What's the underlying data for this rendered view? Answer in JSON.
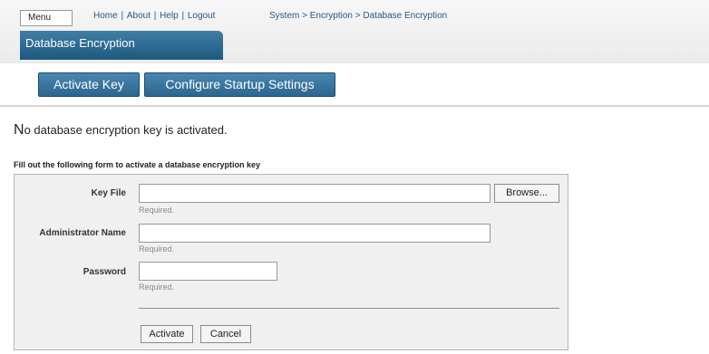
{
  "header": {
    "menu_label": "Menu",
    "links": [
      "Home",
      "About",
      "Help",
      "Logout"
    ],
    "breadcrumb": "System > Encryption > Database Encryption",
    "title": "Database Encryption"
  },
  "toolbar": {
    "activate_key_label": "Activate Key",
    "configure_label": "Configure Startup Settings"
  },
  "status": {
    "first_letter": "N",
    "message_rest": "o database encryption key is activated."
  },
  "form": {
    "caption": "Fill out the following form to activate a database encryption key",
    "fields": [
      {
        "label": "Key File",
        "value": "",
        "hint": "Required."
      },
      {
        "label": "Administrator Name",
        "value": "",
        "hint": "Required."
      },
      {
        "label": "Password",
        "value": "",
        "hint": "Required."
      }
    ],
    "browse_label": "Browse...",
    "activate_label": "Activate",
    "cancel_label": "Cancel"
  }
}
